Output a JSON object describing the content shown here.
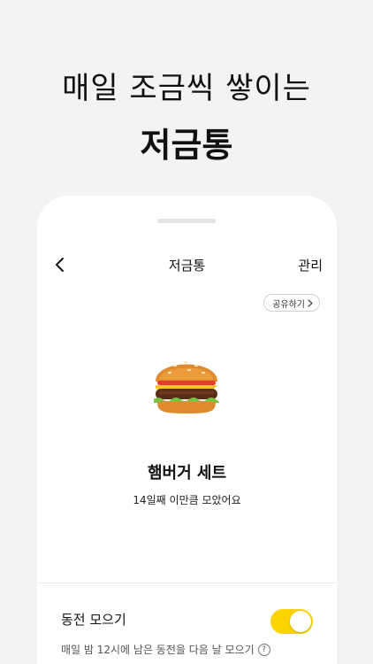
{
  "headline": {
    "line1": "매일 조금씩 쌓이는",
    "line2": "저금통"
  },
  "nav": {
    "back_icon": "chevron-left-icon",
    "title": "저금통",
    "manage_label": "관리"
  },
  "share": {
    "label": "공유하기",
    "icon": "chevron-right-icon"
  },
  "item": {
    "icon": "hamburger-icon",
    "title": "햄버거 세트",
    "subtitle": "14일째 이만큼 모았어요"
  },
  "coin_saving": {
    "label": "동전 모으기",
    "enabled": true,
    "description": "매일 밤 12시에 남은 동전을 다음 날 모으기",
    "help_icon": "question-mark-icon",
    "help_glyph": "?"
  },
  "colors": {
    "background": "#f3f3f3",
    "toggle_on": "#fbd301"
  }
}
